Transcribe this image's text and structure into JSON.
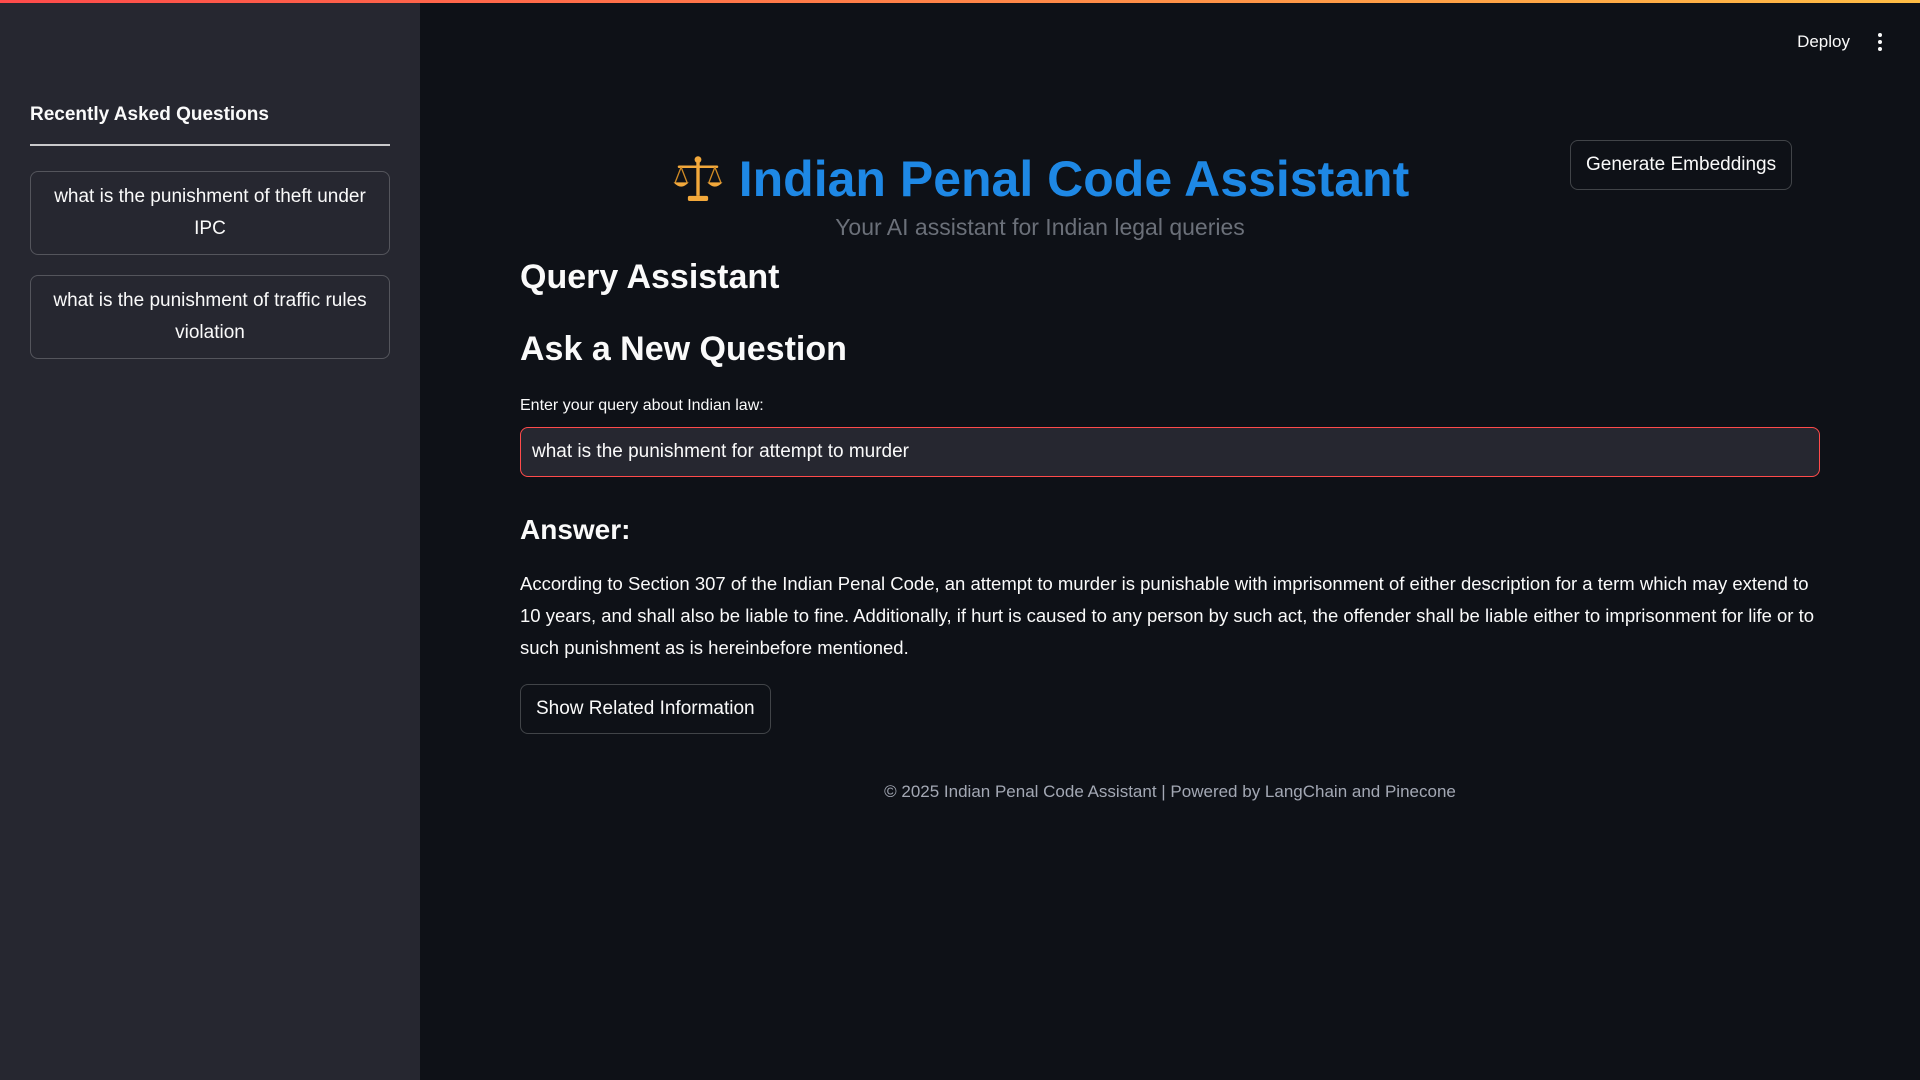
{
  "header": {
    "deploy_label": "Deploy",
    "menu_icon": "kebab-menu-icon"
  },
  "colors": {
    "accent": "#ff4b4b",
    "title": "#1e88e5",
    "background": "#0e1117",
    "sidebar": "#262730"
  },
  "sidebar": {
    "title": "Recently Asked Questions",
    "questions": [
      "what is the punishment of theft under IPC",
      "what is the punishment of traffic rules violation"
    ]
  },
  "main": {
    "title_icon": "scales-icon",
    "title": "Indian Penal Code Assistant",
    "subtitle": "Your AI assistant for Indian legal queries",
    "generate_button": "Generate Embeddings",
    "section_heading": "Query Assistant",
    "ask_heading": "Ask a New Question",
    "input_label": "Enter your query about Indian law:",
    "input_value": "what is the punishment for attempt to murder",
    "answer_heading": "Answer:",
    "answer_text": "According to Section 307 of the Indian Penal Code, an attempt to murder is punishable with imprisonment of either description for a term which may extend to 10 years, and shall also be liable to fine. Additionally, if hurt is caused to any person by such act, the offender shall be liable either to imprisonment for life or to such punishment as is hereinbefore mentioned.",
    "related_button": "Show Related Information",
    "footer": "© 2025 Indian Penal Code Assistant | Powered by LangChain and Pinecone"
  }
}
